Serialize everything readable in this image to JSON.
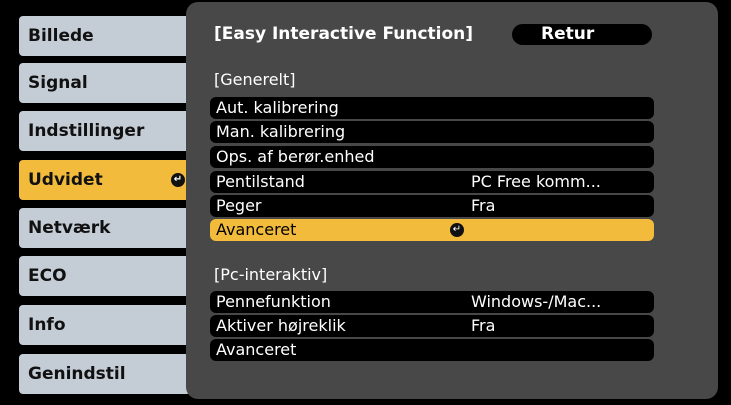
{
  "nav": {
    "items": [
      {
        "label": "Billede"
      },
      {
        "label": "Signal"
      },
      {
        "label": "Indstillinger"
      },
      {
        "label": "Udvidet"
      },
      {
        "label": "Netværk"
      },
      {
        "label": "ECO"
      },
      {
        "label": "Info"
      },
      {
        "label": "Genindstil"
      }
    ],
    "selected_index": 3
  },
  "panel": {
    "title": "[Easy Interactive Function]",
    "back_label": "Retur",
    "general": {
      "heading": "[Generelt]",
      "rows": [
        {
          "label": "Aut. kalibrering",
          "value": ""
        },
        {
          "label": "Man. kalibrering",
          "value": ""
        },
        {
          "label": "Ops. af berør.enhed",
          "value": ""
        },
        {
          "label": "Pentilstand",
          "value": "PC Free komm..."
        },
        {
          "label": "Peger",
          "value": "Fra"
        },
        {
          "label": "Avanceret",
          "value": ""
        }
      ]
    },
    "pc": {
      "heading": "[Pc-interaktiv]",
      "rows": [
        {
          "label": "Pennefunktion",
          "value": "Windows-/Mac..."
        },
        {
          "label": "Aktiver højreklik",
          "value": "Fra"
        },
        {
          "label": "Avanceret",
          "value": ""
        }
      ]
    }
  },
  "colors": {
    "accent": "#f2bb3b",
    "panel": "#484848",
    "nav_bg": "#c4ccd5"
  }
}
